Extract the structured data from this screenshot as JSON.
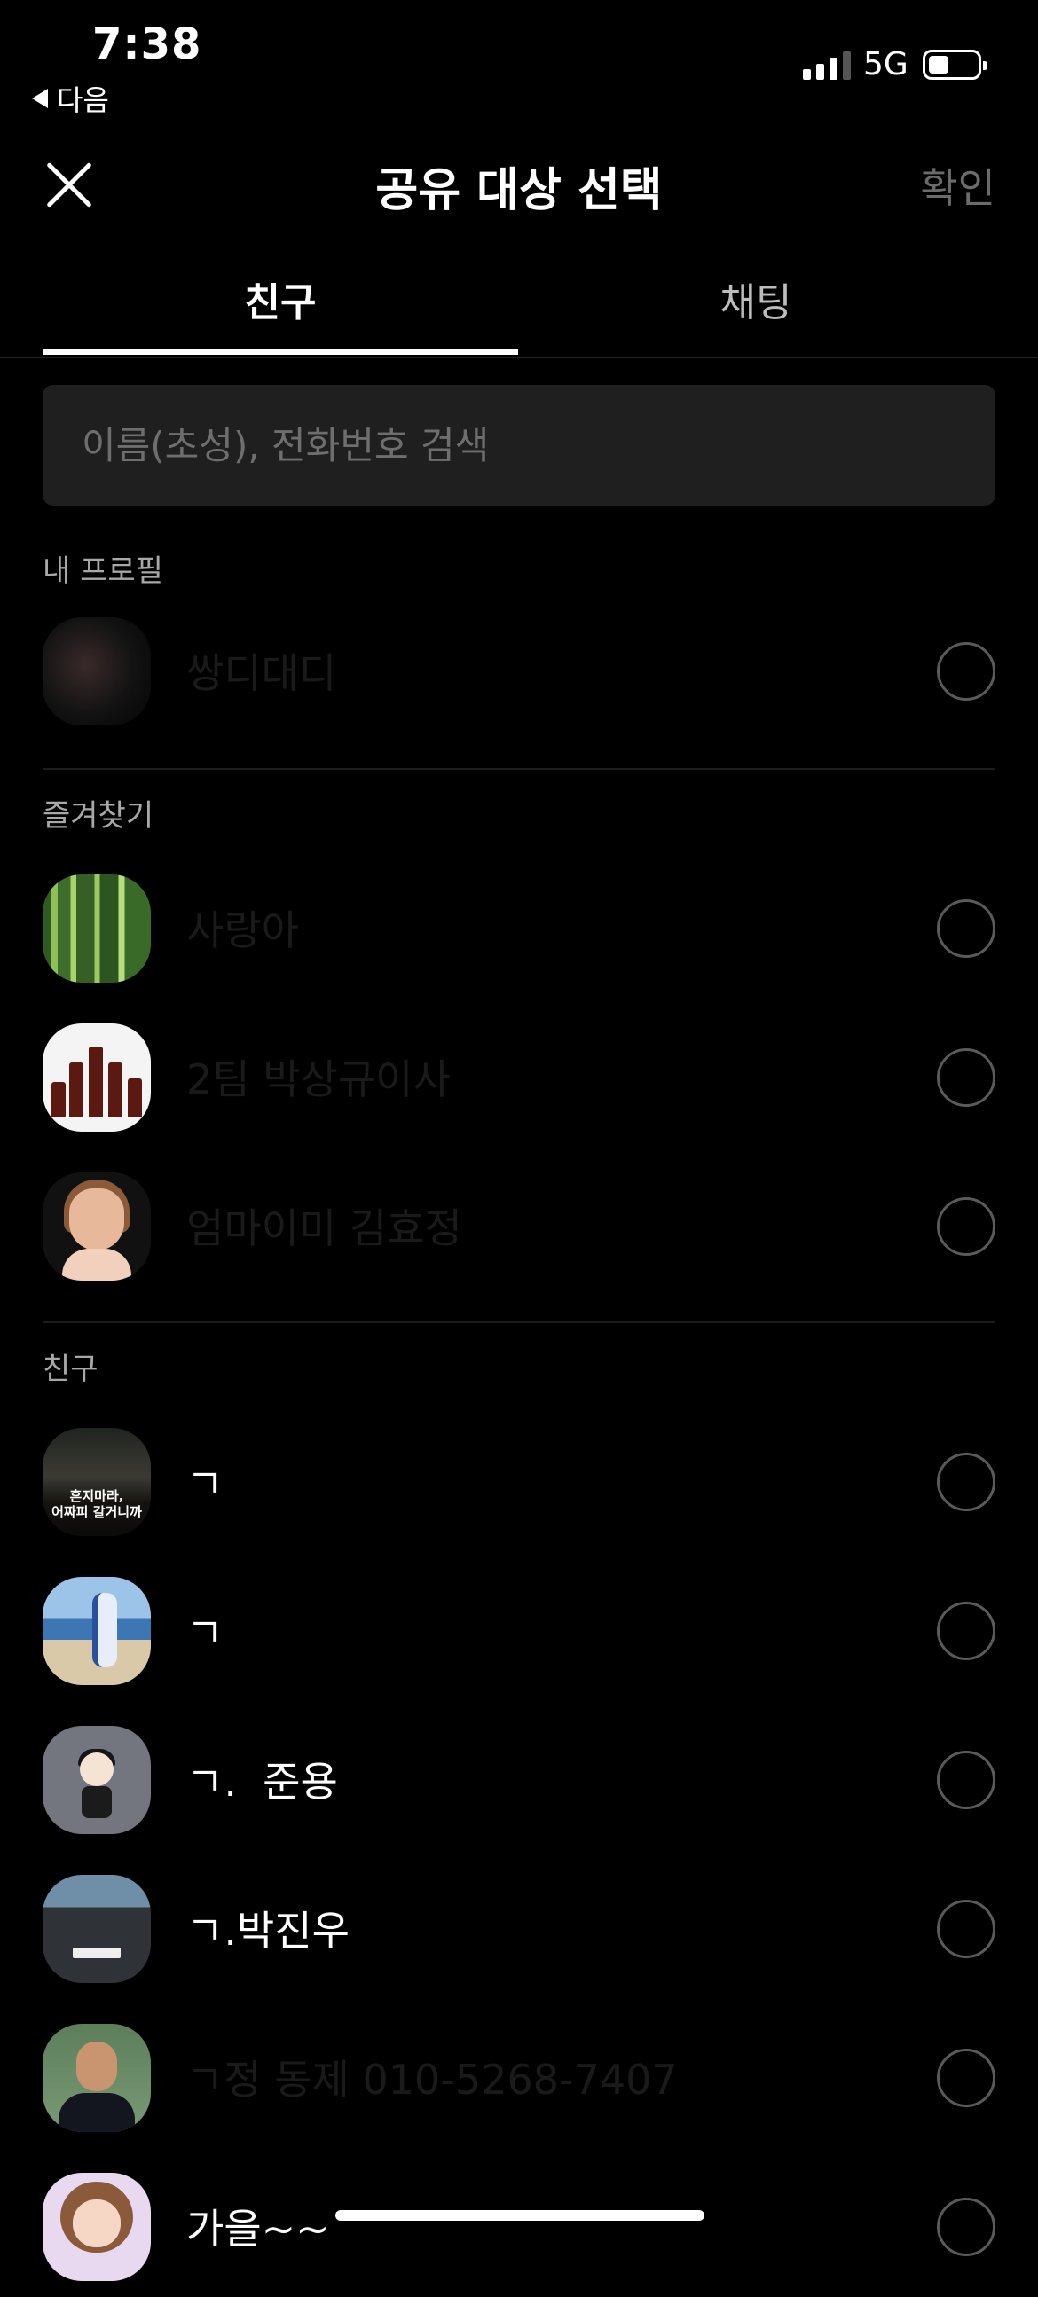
{
  "status_bar": {
    "time": "7:38",
    "back_app": "다음",
    "network": "5G"
  },
  "header": {
    "title": "공유 대상 선택",
    "confirm_label": "확인"
  },
  "tabs": [
    {
      "label": "친구",
      "active": true
    },
    {
      "label": "채팅",
      "active": false
    }
  ],
  "search": {
    "placeholder": "이름(초성), 전화번호 검색",
    "value": ""
  },
  "sections": {
    "my_profile": {
      "label": "내 프로필",
      "items": [
        {
          "name": "쌍디대디"
        }
      ]
    },
    "favorites": {
      "label": "즐겨찾기",
      "items": [
        {
          "name": "사랑아"
        },
        {
          "name": "2팀 박상규이사"
        },
        {
          "name": "엄마이미 김효정"
        }
      ]
    },
    "friends": {
      "label": "친구",
      "items": [
        {
          "name": "ㄱ"
        },
        {
          "name": "ㄱ"
        },
        {
          "name": "ㄱ.  준용"
        },
        {
          "name": "ㄱ.박진우"
        },
        {
          "name": "ㄱ정 동제 010-5268-7407"
        },
        {
          "name": "가을~~"
        }
      ]
    }
  },
  "avatar_caption": "흔지마라,\n어짜피 갈거니까",
  "colors": {
    "background": "#000000",
    "search_bg": "#1f1f1f",
    "muted_text": "#a8a8a8",
    "radio_border": "#5a5a5a"
  }
}
